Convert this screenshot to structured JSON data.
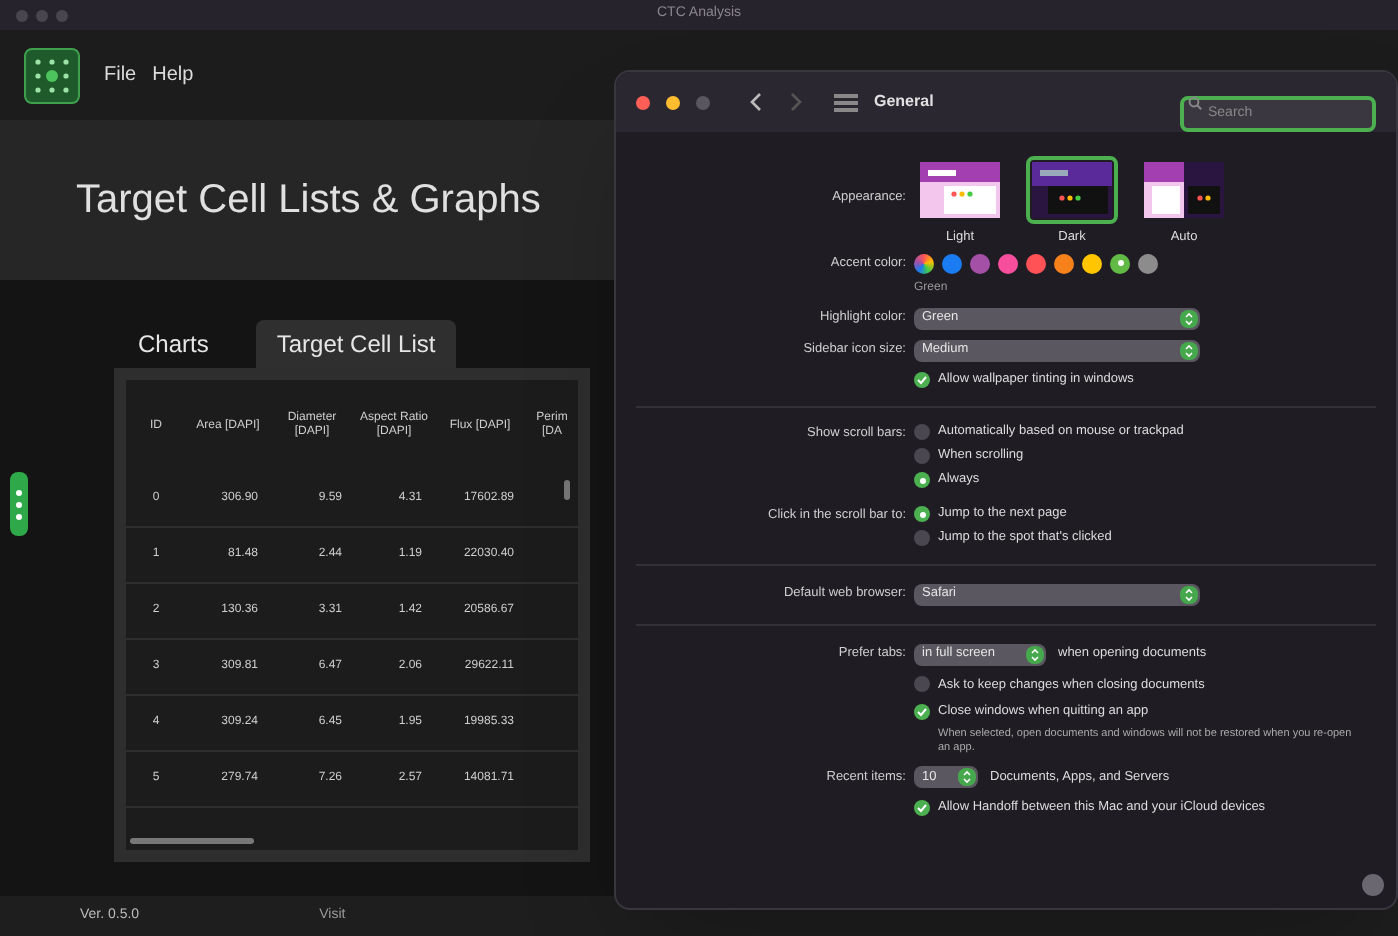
{
  "app": {
    "window_title": "CTC Analysis",
    "menu": [
      "File",
      "Help"
    ],
    "heading": "Target Cell Lists & Graphs",
    "tabs": [
      {
        "label": "Charts",
        "selected": false
      },
      {
        "label": "Target Cell List",
        "selected": true
      }
    ],
    "table": {
      "columns": [
        "ID",
        "Area [DAPI]",
        "Diameter [DAPI]",
        "Aspect Ratio [DAPI]",
        "Flux [DAPI]",
        "Perim [DA"
      ],
      "rows": [
        [
          "0",
          "306.90",
          "9.59",
          "4.31",
          "17602.89"
        ],
        [
          "1",
          "81.48",
          "2.44",
          "1.19",
          "22030.40"
        ],
        [
          "2",
          "130.36",
          "3.31",
          "1.42",
          "20586.67"
        ],
        [
          "3",
          "309.81",
          "6.47",
          "2.06",
          "29622.11"
        ],
        [
          "4",
          "309.24",
          "6.45",
          "1.95",
          "19985.33"
        ],
        [
          "5",
          "279.74",
          "7.26",
          "2.57",
          "14081.71"
        ]
      ]
    },
    "footer": {
      "version": "Ver. 0.5.0",
      "text": "Visit"
    }
  },
  "settings": {
    "title": "General",
    "search_placeholder": "Search",
    "appearance": {
      "label": "Appearance:",
      "options": [
        {
          "label": "Light",
          "selected": false
        },
        {
          "label": "Dark",
          "selected": true
        },
        {
          "label": "Auto",
          "selected": false
        }
      ]
    },
    "accent_color": {
      "label": "Accent color:",
      "caption": "Green",
      "colors": [
        {
          "kind": "multicolor",
          "selected": false
        },
        {
          "kind": "solid",
          "color": "#1a7cf0",
          "selected": false
        },
        {
          "kind": "solid",
          "color": "#a550a7",
          "selected": false
        },
        {
          "kind": "solid",
          "color": "#f74f9e",
          "selected": false
        },
        {
          "kind": "solid",
          "color": "#ff5257",
          "selected": false
        },
        {
          "kind": "solid",
          "color": "#f7821b",
          "selected": false
        },
        {
          "kind": "solid",
          "color": "#ffc600",
          "selected": false
        },
        {
          "kind": "solid",
          "color": "#62ba46",
          "selected": true
        },
        {
          "kind": "solid",
          "color": "#8c8c8c",
          "selected": false
        }
      ]
    },
    "highlight_color": {
      "label": "Highlight color:",
      "value": "Green"
    },
    "sidebar_icon_size": {
      "label": "Sidebar icon size:",
      "value": "Medium"
    },
    "wallpaper_tinting": {
      "label": "Allow wallpaper tinting in windows",
      "checked": true
    },
    "scroll_bars": {
      "label": "Show scroll bars:",
      "options": [
        {
          "label": "Automatically based on mouse or trackpad",
          "selected": false
        },
        {
          "label": "When scrolling",
          "selected": false
        },
        {
          "label": "Always",
          "selected": true
        }
      ]
    },
    "scroll_click": {
      "label": "Click in the scroll bar to:",
      "options": [
        {
          "label": "Jump to the next page",
          "selected": true
        },
        {
          "label": "Jump to the spot that's clicked",
          "selected": false
        }
      ]
    },
    "default_browser": {
      "label": "Default web browser:",
      "value": "Safari"
    },
    "prefer_tabs": {
      "label": "Prefer tabs:",
      "value": "in full screen",
      "suffix": "when opening documents"
    },
    "ask_keep_changes": {
      "label": "Ask to keep changes when closing documents",
      "checked": false
    },
    "close_windows": {
      "label": "Close windows when quitting an app",
      "checked": true,
      "note": "When selected, open documents and windows will not be restored when you re-open an app."
    },
    "recent_items": {
      "label": "Recent items:",
      "value": "10",
      "suffix": "Documents, Apps, and Servers"
    },
    "handoff": {
      "label": "Allow Handoff between this Mac and your iCloud devices",
      "checked": true
    }
  }
}
